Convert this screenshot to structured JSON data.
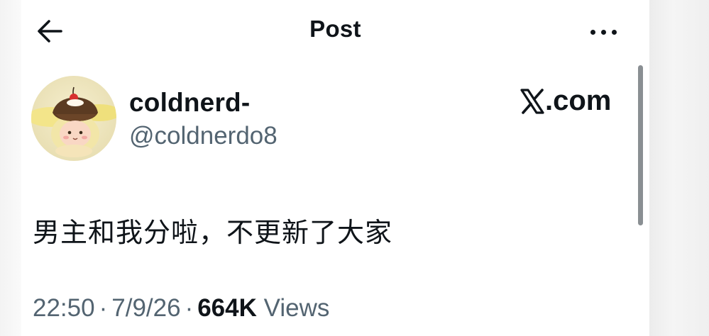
{
  "header": {
    "title": "Post",
    "back_icon": "arrow-left-icon",
    "more_icon": "more-horizontal-icon"
  },
  "author": {
    "display_name": "coldnerd-",
    "handle": "@coldnerdo8",
    "avatar_icon": "avatar-pudding-character"
  },
  "brand": {
    "logo_icon": "x-logo-icon",
    "suffix": ".com"
  },
  "post": {
    "text": "男主和我分啦，不更新了大家"
  },
  "meta": {
    "time": "22:50",
    "date": "7/9/26",
    "separator": "·",
    "views_count": "664K",
    "views_label": "Views"
  },
  "colors": {
    "text_primary": "#0f1419",
    "text_secondary": "#536471",
    "background": "#ffffff"
  }
}
